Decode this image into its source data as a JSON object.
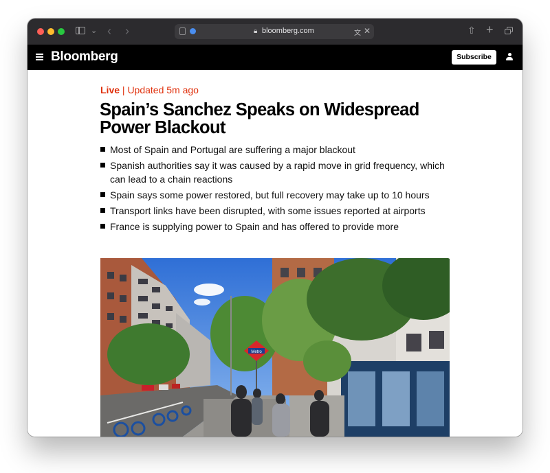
{
  "browser": {
    "url": "bloomberg.com",
    "icons": [
      "sidebar-icon",
      "chevron-down-icon",
      "back-icon",
      "forward-icon",
      "tab-overview-icon",
      "globe-icon",
      "lock-icon",
      "translate-icon",
      "close-icon",
      "share-icon",
      "new-tab-icon",
      "tabs-icon"
    ]
  },
  "site": {
    "brand": "Bloomberg",
    "subscribe_label": "Subscribe",
    "icons": [
      "menu-icon",
      "user-icon"
    ]
  },
  "article": {
    "live_label": "Live",
    "separator": "|",
    "updated": "Updated 5m ago",
    "headline": "Spain’s Sanchez Speaks on Widespread Power Blackout",
    "bullets": [
      "Most of Spain and Portugal are suffering a major blackout",
      "Spanish authorities say it was caused by a rapid move in grid frequency, which can lead to a chain reactions",
      "Spain says some power restored, but full recovery may take up to 10 hours",
      "Transport links have been disrupted, with some issues reported at airports",
      "France is supplying power to Spain and has offered to provide more"
    ],
    "photo_sign": "Metro"
  },
  "colors": {
    "live_red": "#e0310d",
    "titlebar": "#2c2b2e",
    "navbar": "#000000"
  }
}
